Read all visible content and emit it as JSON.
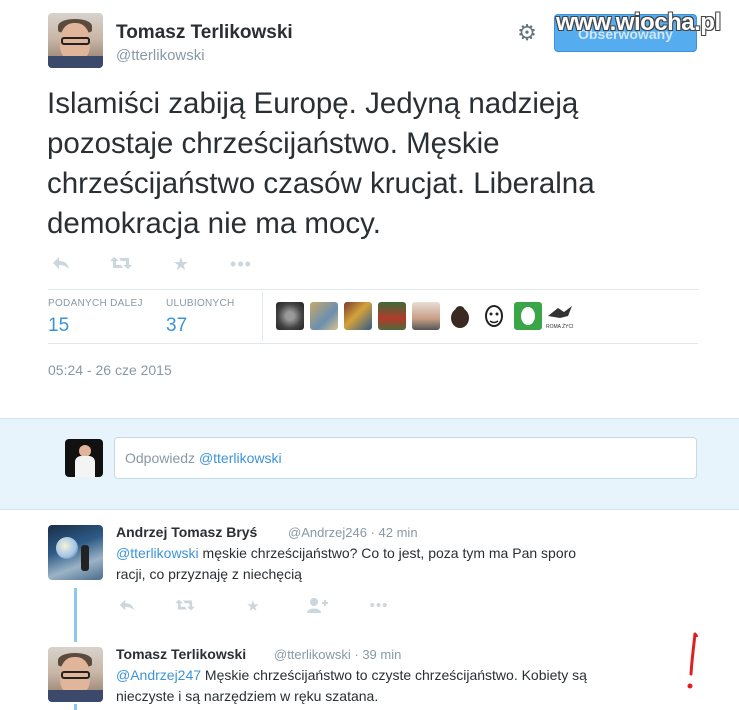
{
  "tweet": {
    "author_name": "Tomasz Terlikowski",
    "author_handle": "@tterlikowski",
    "follow_label": "Obserwowany",
    "watermark": "www.wiocha.pl",
    "text": "Islamiści zabiją Europę. Jedyną nadzieją pozostaje chrześcijaństwo. Męskie chrześcijaństwo czasów krucjat. Liberalna demokracja nie ma mocy.",
    "actions": {
      "reply_icon": "reply-icon",
      "retweet_icon": "retweet-icon",
      "favorite_icon": "star-icon",
      "more_icon": "more-icon"
    },
    "stats": {
      "retweets_label": "PODANYCH DALEJ",
      "retweets_count": "15",
      "favorites_label": "ULUBIONYCH",
      "favorites_count": "37"
    },
    "favoriters_caption": "ROMA ŻYCI",
    "timestamp": "05:24 - 26 cze 2015"
  },
  "reply_box": {
    "placeholder_prefix": "Odpowiedz ",
    "placeholder_mention": "@tterlikowski"
  },
  "replies": [
    {
      "name": "Andrzej Tomasz Bryś",
      "handle": "@Andrzej246",
      "time": "42 min",
      "mention": "@tterlikowski",
      "text_line1": " męskie chrześcijaństwo?  Co to jest,  poza tym ma Pan sporo",
      "text_line2": "racji,  co przyznaję z niechęcią"
    },
    {
      "name": "Tomasz Terlikowski",
      "handle": "@tterlikowski",
      "time": "39 min",
      "mention": "@Andrzej247",
      "text_line1": " Męskie chrześcijaństwo to czyste chrześcijaństwo. Kobiety są",
      "text_line2": "nieczyste i są narzędziem w ręku szatana."
    }
  ],
  "colors": {
    "link": "#3b94d9",
    "muted": "#8899a6",
    "follow_bg": "#55acee",
    "reply_bg": "#e8f4fb",
    "thread_line": "#8ccbe8",
    "annotation": "#e02020"
  }
}
